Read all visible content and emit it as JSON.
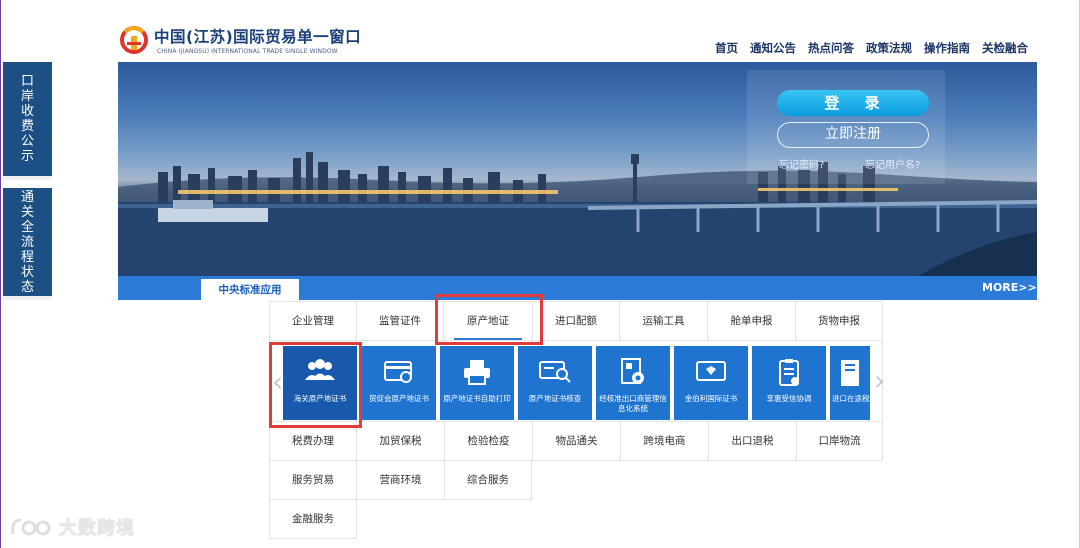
{
  "header": {
    "title": "中国(江苏)国际贸易单一窗口",
    "subtitle": "CHINA (JIANGSU) INTERNATIONAL TRADE SINGLE WINDOW",
    "nav": [
      "首页",
      "通知公告",
      "热点问答",
      "政策法规",
      "操作指南",
      "关检融合"
    ]
  },
  "side_tabs": [
    {
      "label": [
        "口",
        "岸",
        "收",
        "费",
        "公",
        "示"
      ]
    },
    {
      "label": [
        "通",
        "关",
        "全",
        "流",
        "程",
        "状",
        "态"
      ]
    }
  ],
  "login": {
    "login_button": "登 录",
    "register_button": "立即注册",
    "forgot_password": "忘记密码?",
    "forgot_username": "忘记用户名?"
  },
  "strip": {
    "tab": "中央标准应用",
    "more": "MORE>>"
  },
  "tabs_row1": [
    "企业管理",
    "监管证件",
    "原产地证",
    "进口配额",
    "运输工具",
    "舱单申报",
    "货物申报"
  ],
  "active_tab": "原产地证",
  "tiles": [
    {
      "label": "海关原产地证书",
      "icon": "people-icon"
    },
    {
      "label": "贸促会原产地证书",
      "icon": "card-icon"
    },
    {
      "label": "原产地证书自助打印",
      "icon": "printer-icon"
    },
    {
      "label": "原产地证书核查",
      "icon": "card-search-icon"
    },
    {
      "label": "经核准出口商管理信息化系统",
      "icon": "document-gear-icon"
    },
    {
      "label": "金伯利国际证书",
      "icon": "diamond-card-icon"
    },
    {
      "label": "享惠受信协调",
      "icon": "clipboard-icon"
    },
    {
      "label": "进口在途税税率适",
      "icon": "book-icon"
    }
  ],
  "tabs_row2": [
    "税费办理",
    "加贸保税",
    "检验检疫",
    "物品通关",
    "跨境电商",
    "出口退税",
    "口岸物流"
  ],
  "tabs_row3": [
    "服务贸易",
    "营商环境",
    "综合服务"
  ],
  "tabs_row4": [
    "金融服务"
  ],
  "watermark": "大数跨境",
  "colors": {
    "primary_blue": "#2c7bd8",
    "tile_blue": "#1f74d0",
    "highlight_red": "#e03b3b",
    "nav_text": "#1a3566"
  }
}
